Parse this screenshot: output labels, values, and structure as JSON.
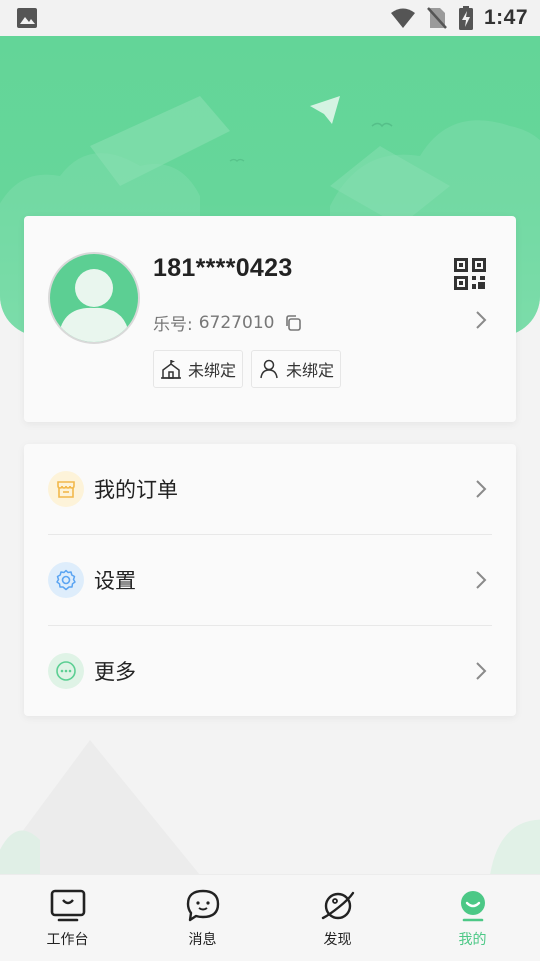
{
  "status_bar": {
    "time": "1:47"
  },
  "profile": {
    "phone": "181****0423",
    "leid_label": "乐号:",
    "leid_value": "6727010",
    "tags": [
      {
        "label": "未绑定",
        "icon": "school-icon"
      },
      {
        "label": "未绑定",
        "icon": "person-icon"
      }
    ]
  },
  "menu": [
    {
      "label": "我的订单",
      "icon": "order-icon",
      "color": "#f2b84b",
      "bg": "#fdf3d9"
    },
    {
      "label": "设置",
      "icon": "settings-icon",
      "color": "#5aa4f2",
      "bg": "#deedfb"
    },
    {
      "label": "更多",
      "icon": "more-icon",
      "color": "#5ccf93",
      "bg": "#dff3e6"
    }
  ],
  "tabbar": {
    "tabs": [
      {
        "label": "工作台",
        "icon": "workbench-icon",
        "active": false
      },
      {
        "label": "消息",
        "icon": "message-icon",
        "active": false
      },
      {
        "label": "发现",
        "icon": "discover-icon",
        "active": false
      },
      {
        "label": "我的",
        "icon": "profile-icon",
        "active": true
      }
    ],
    "active_color": "#4cc886"
  },
  "theme": {
    "primary": "#63d598"
  }
}
